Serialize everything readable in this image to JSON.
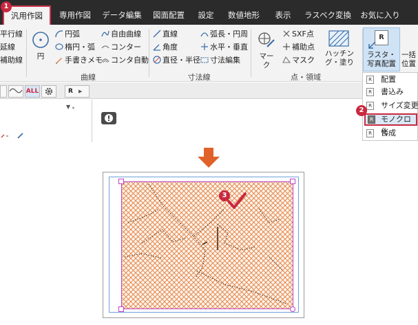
{
  "tabs": [
    {
      "label": "汎用作図",
      "active": true
    },
    {
      "label": "専用作図"
    },
    {
      "label": "データ編集"
    },
    {
      "label": "図面配置"
    },
    {
      "label": "設定"
    },
    {
      "label": "数値地形"
    },
    {
      "label": "表示"
    },
    {
      "label": "ラスベク変換"
    },
    {
      "label": "お気に入り"
    }
  ],
  "ribbon": {
    "left_partial": [
      "平行線",
      "延線",
      "補助線"
    ],
    "circle_label": "円",
    "curve": {
      "items": [
        "円弧",
        "楕円・弧",
        "手書きメモ",
        "自由曲線",
        "コンター",
        "コンタ自動"
      ],
      "label": "曲線"
    },
    "dimension": {
      "items": [
        "直線",
        "角度",
        "直径・半径",
        "弧長・円周",
        "水平・垂直",
        "寸法編集"
      ],
      "label": "寸法線"
    },
    "point_area": {
      "items": [
        "SXF点",
        "補助点",
        "マスク"
      ],
      "mark_label": "マーク",
      "hatching_label": "ハッチング・塗り",
      "label": "点・領域"
    },
    "raster": {
      "label": "ラスタ・写真配置",
      "icon_letter": "R"
    },
    "partial_right": "一括位置"
  },
  "toolbar": {
    "all_label": "ALL",
    "r_label": "R"
  },
  "dropdown": {
    "items": [
      "配置",
      "書込み",
      "サイズ変更",
      "モノクロ化",
      "合成"
    ],
    "highlighted": "モノクロ化"
  },
  "badges": [
    "1",
    "2",
    "3"
  ],
  "colors": {
    "accent": "#c9283f",
    "hatch": "#e07d3c",
    "tab_bg": "#2b2b2b",
    "arrow": "#e0622a",
    "frame": "#c040c0"
  }
}
